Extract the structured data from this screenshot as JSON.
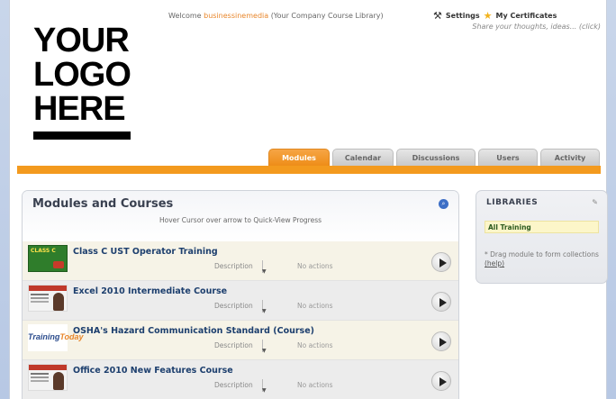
{
  "header": {
    "logo_lines": [
      "YOUR",
      "LOGO",
      "HERE"
    ],
    "welcome_prefix": "Welcome",
    "username": "businessinemedia",
    "library_label": "(Your Company Course Library)",
    "settings_label": "Settings",
    "certificates_label": "My Certificates",
    "share_text": "Share your thoughts, ideas... (click)"
  },
  "tabs": [
    {
      "label": "Modules",
      "active": true
    },
    {
      "label": "Calendar",
      "active": false
    },
    {
      "label": "Discussions",
      "active": false
    },
    {
      "label": "Users",
      "active": false
    },
    {
      "label": "Activity",
      "active": false
    }
  ],
  "main": {
    "title": "Modules and Courses",
    "hover_hint": "Hover Cursor over arrow to Quick-View Progress",
    "courses": [
      {
        "title": "Class C UST Operator Training",
        "description": "Description",
        "actions": "No actions",
        "thumb_text": "CLASS C"
      },
      {
        "title": "Excel 2010 Intermediate Course",
        "description": "Description",
        "actions": "No actions"
      },
      {
        "title": "OSHA's Hazard Communication Standard (Course)",
        "description": "Description",
        "actions": "No actions",
        "thumb_text_a": "Training",
        "thumb_text_b": "Today"
      },
      {
        "title": "Office 2010 New Features Course",
        "description": "Description",
        "actions": "No actions"
      }
    ]
  },
  "libraries": {
    "title": "LIBRARIES",
    "item": "All Training",
    "note_prefix": "* Drag module to form collections",
    "help_link": "(help)"
  },
  "colors": {
    "accent": "#f39a1e",
    "title_blue": "#1d3f6e",
    "username": "#e8862a"
  }
}
